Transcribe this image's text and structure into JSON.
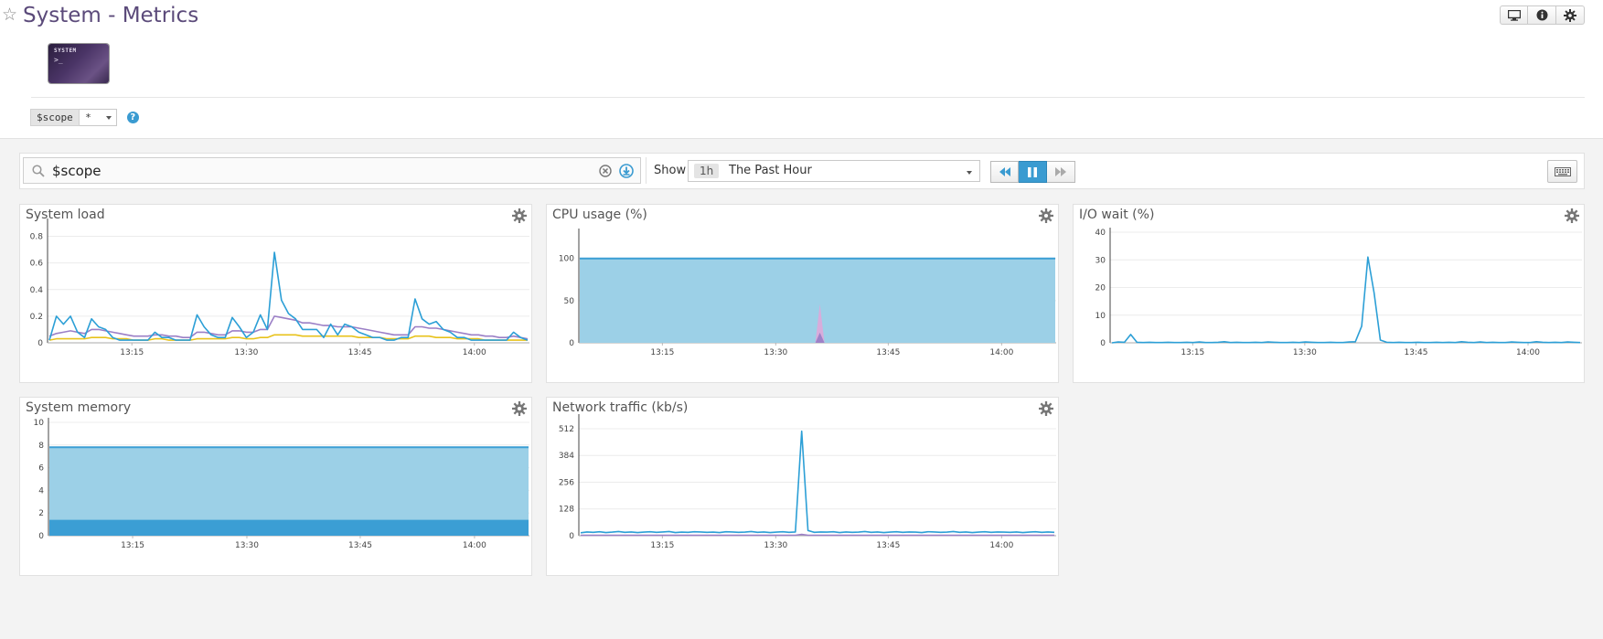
{
  "header": {
    "title": "System - Metrics",
    "logo_text": "SYSTEM",
    "logo_prompt": ">_",
    "buttons": [
      "monitor-icon",
      "info-icon",
      "gear-icon"
    ]
  },
  "template_variable": {
    "name": "$scope",
    "value": "*"
  },
  "toolbar": {
    "search_value": "$scope",
    "show_label": "Show",
    "range_badge": "1h",
    "range_text": "The Past Hour"
  },
  "colors": {
    "blue": "#2c9fd6",
    "purple": "#9b7fc6",
    "yellow": "#e8c21b",
    "area_fill": "#9cd0e7",
    "area_dark": "#3b9ed4",
    "accent": "#3a9bd1"
  },
  "widgets": [
    {
      "title": "System load",
      "chart_data": {
        "type": "line",
        "x_ticks": [
          "13:15",
          "13:30",
          "13:45",
          "14:00"
        ],
        "y_ticks": [
          "0",
          "0.2",
          "0.4",
          "0.6",
          "0.8"
        ],
        "ylim": [
          0,
          0.9
        ],
        "series": [
          {
            "color": "blue",
            "values": [
              0.02,
              0.2,
              0.14,
              0.2,
              0.08,
              0.04,
              0.18,
              0.12,
              0.1,
              0.04,
              0.02,
              0.02,
              0.02,
              0.02,
              0.02,
              0.08,
              0.04,
              0.04,
              0.02,
              0.02,
              0.02,
              0.21,
              0.12,
              0.06,
              0.04,
              0.04,
              0.19,
              0.12,
              0.04,
              0.08,
              0.21,
              0.1,
              0.68,
              0.32,
              0.22,
              0.18,
              0.1,
              0.1,
              0.1,
              0.04,
              0.14,
              0.06,
              0.14,
              0.12,
              0.08,
              0.06,
              0.04,
              0.04,
              0.02,
              0.02,
              0.04,
              0.04,
              0.33,
              0.18,
              0.14,
              0.16,
              0.1,
              0.08,
              0.04,
              0.04,
              0.02,
              0.02,
              0.02,
              0.02,
              0.02,
              0.02,
              0.08,
              0.04,
              0.02
            ]
          },
          {
            "color": "purple",
            "values": [
              0.05,
              0.07,
              0.08,
              0.09,
              0.08,
              0.07,
              0.1,
              0.1,
              0.09,
              0.08,
              0.07,
              0.06,
              0.05,
              0.05,
              0.05,
              0.06,
              0.06,
              0.05,
              0.05,
              0.04,
              0.04,
              0.08,
              0.08,
              0.07,
              0.06,
              0.06,
              0.09,
              0.09,
              0.08,
              0.08,
              0.1,
              0.1,
              0.2,
              0.19,
              0.18,
              0.17,
              0.15,
              0.15,
              0.14,
              0.13,
              0.13,
              0.12,
              0.12,
              0.12,
              0.11,
              0.1,
              0.09,
              0.08,
              0.07,
              0.06,
              0.06,
              0.06,
              0.12,
              0.12,
              0.11,
              0.11,
              0.1,
              0.09,
              0.08,
              0.07,
              0.06,
              0.06,
              0.05,
              0.05,
              0.04,
              0.04,
              0.05,
              0.04,
              0.03
            ]
          },
          {
            "color": "yellow",
            "values": [
              0.02,
              0.03,
              0.03,
              0.03,
              0.03,
              0.03,
              0.04,
              0.04,
              0.04,
              0.03,
              0.03,
              0.03,
              0.02,
              0.02,
              0.02,
              0.03,
              0.03,
              0.02,
              0.02,
              0.02,
              0.02,
              0.03,
              0.03,
              0.03,
              0.03,
              0.03,
              0.04,
              0.04,
              0.03,
              0.03,
              0.04,
              0.04,
              0.06,
              0.06,
              0.06,
              0.06,
              0.05,
              0.05,
              0.05,
              0.05,
              0.05,
              0.05,
              0.05,
              0.05,
              0.04,
              0.04,
              0.04,
              0.04,
              0.03,
              0.03,
              0.03,
              0.03,
              0.05,
              0.05,
              0.05,
              0.04,
              0.04,
              0.04,
              0.03,
              0.03,
              0.03,
              0.03,
              0.02,
              0.02,
              0.02,
              0.02,
              0.02,
              0.02,
              0.02
            ]
          }
        ]
      }
    },
    {
      "title": "CPU usage (%)",
      "chart_data": {
        "type": "area",
        "x_ticks": [
          "13:15",
          "13:30",
          "13:45",
          "14:00"
        ],
        "y_ticks": [
          "0",
          "50",
          "100"
        ],
        "ylim": [
          0,
          130
        ],
        "total": 100,
        "spikes": [
          {
            "color": "pink",
            "value": 46
          },
          {
            "color": "purple",
            "value": 12
          }
        ]
      }
    },
    {
      "title": "I/O wait (%)",
      "chart_data": {
        "type": "line",
        "x_ticks": [
          "13:15",
          "13:30",
          "13:45",
          "14:00"
        ],
        "y_ticks": [
          "0",
          "10",
          "20",
          "30",
          "40"
        ],
        "ylim": [
          0,
          40
        ],
        "series": [
          {
            "color": "blue",
            "values": [
              0,
              0.3,
              0.2,
              3,
              0.2,
              0.1,
              0.2,
              0.1,
              0.1,
              0.2,
              0.1,
              0.1,
              0.2,
              0.1,
              0.3,
              0.1,
              0.1,
              0.2,
              0.4,
              0.1,
              0.2,
              0.1,
              0.1,
              0.2,
              0.1,
              0.3,
              0.2,
              0.1,
              0.1,
              0.2,
              0.1,
              0.3,
              0.2,
              0.1,
              0.1,
              0.2,
              0.1,
              0.1,
              0.3,
              0.4,
              6,
              31,
              18,
              1,
              0.2,
              0.1,
              0.2,
              0.1,
              0.1,
              0.2,
              0.1,
              0.1,
              0.2,
              0.1,
              0.2,
              0.1,
              0.4,
              0.2,
              0.1,
              0.3,
              0.1,
              0.2,
              0.1,
              0.1,
              0.3,
              0.2,
              0.1,
              0.1,
              0.4,
              0.2,
              0.1,
              0.2,
              0.1,
              0.3,
              0.2,
              0.1
            ]
          }
        ]
      }
    },
    {
      "title": "System memory",
      "chart_data": {
        "type": "area",
        "x_ticks": [
          "13:15",
          "13:30",
          "13:45",
          "14:00"
        ],
        "y_ticks": [
          "0",
          "2",
          "4",
          "6",
          "8",
          "10"
        ],
        "ylim": [
          0,
          10
        ],
        "total": 7.8,
        "used": 1.4
      }
    },
    {
      "title": "Network traffic (kb/s)",
      "chart_data": {
        "type": "line",
        "x_ticks": [
          "13:15",
          "13:30",
          "13:45",
          "14:00"
        ],
        "y_ticks": [
          "0",
          "128",
          "256",
          "384",
          "512"
        ],
        "ylim": [
          0,
          560
        ],
        "series": [
          {
            "color": "blue",
            "values": [
              14,
              18,
              16,
              19,
              15,
              17,
              20,
              16,
              18,
              15,
              17,
              19,
              16,
              18,
              20,
              15,
              17,
              16,
              19,
              18,
              16,
              17,
              15,
              19,
              18,
              16,
              17,
              20,
              16,
              18,
              15,
              17,
              19,
              16,
              18,
              500,
              25,
              16,
              18,
              17,
              19,
              15,
              18,
              16,
              17,
              20,
              16,
              18,
              15,
              17,
              19,
              16,
              18,
              17,
              15,
              19,
              18,
              16,
              17,
              20,
              16,
              18,
              15,
              17,
              19,
              16,
              18,
              17,
              16,
              18,
              15,
              17,
              19,
              16,
              18,
              16
            ]
          },
          {
            "color": "purple",
            "values": [
              2,
              2,
              2,
              2,
              2,
              2,
              2,
              2,
              2,
              2,
              2,
              2,
              2,
              2,
              2,
              2,
              2,
              2,
              2,
              2,
              2,
              2,
              2,
              2,
              2,
              2,
              2,
              2,
              2,
              2,
              2,
              2,
              2,
              2,
              2,
              6,
              2,
              2,
              2,
              2,
              2,
              2,
              2,
              2,
              2,
              2,
              2,
              2,
              2,
              2,
              2,
              2,
              2,
              2,
              2,
              2,
              2,
              2,
              2,
              2,
              2,
              2,
              2,
              2,
              2,
              2,
              2,
              2,
              2,
              2,
              2,
              2,
              2,
              2,
              2,
              2
            ]
          }
        ]
      }
    }
  ]
}
